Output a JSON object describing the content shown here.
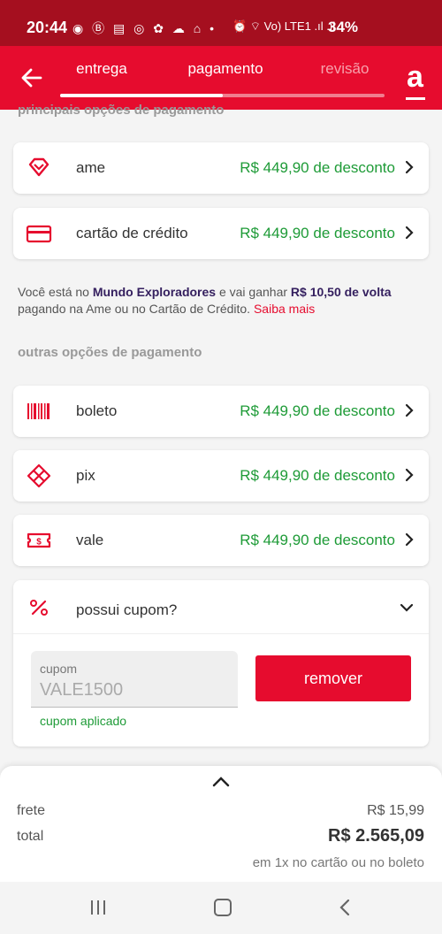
{
  "status_bar": {
    "time": "20:44",
    "notifications": "◉ Ⓑ ▤ ◎ ✿ ☁ ⌂ •",
    "system": "⏰ ⌔ Vo) LTE1 .ıl .ıl",
    "battery": "34%"
  },
  "header": {
    "tabs": [
      {
        "label": "entrega"
      },
      {
        "label": "pagamento"
      },
      {
        "label": "revisão"
      }
    ],
    "progress_fraction": 0.5,
    "brand": "a",
    "accent_color": "#e60c2e"
  },
  "partial_heading": "principais opções de pagamento",
  "main_options": [
    {
      "label": "ame",
      "discount": "R$ 449,90 de desconto",
      "icon": "heart-icon"
    },
    {
      "label": "cartão de crédito",
      "discount": "R$ 449,90 de desconto",
      "icon": "credit-card-icon"
    }
  ],
  "info": {
    "text1": "Você está no ",
    "program": "Mundo Exploradores",
    "text2": " e vai ganhar ",
    "cashback": "R$ 10,50 de volta",
    "text3": " pagando na Ame ou no Cartão de Crédito. ",
    "link": "Saiba mais"
  },
  "other_heading": "outras opções de pagamento",
  "other_options": [
    {
      "label": "boleto",
      "discount": "R$ 449,90 de desconto",
      "icon": "barcode-icon"
    },
    {
      "label": "pix",
      "discount": "R$ 449,90 de desconto",
      "icon": "pix-icon"
    },
    {
      "label": "vale",
      "discount": "R$ 449,90 de desconto",
      "icon": "voucher-icon"
    }
  ],
  "coupon": {
    "title": "possui cupom?",
    "field_label": "cupom",
    "field_value": "VALE1500",
    "applied_text": "cupom aplicado",
    "remove_label": "remover"
  },
  "summary": {
    "frete_label": "frete",
    "frete_value": "R$ 15,99",
    "total_label": "total",
    "total_value": "R$ 2.565,09",
    "note": "em 1x no cartão ou no boleto"
  },
  "colors": {
    "discount": "#1e9b37",
    "status_bar": "#a50f1f",
    "program": "#35205f"
  }
}
